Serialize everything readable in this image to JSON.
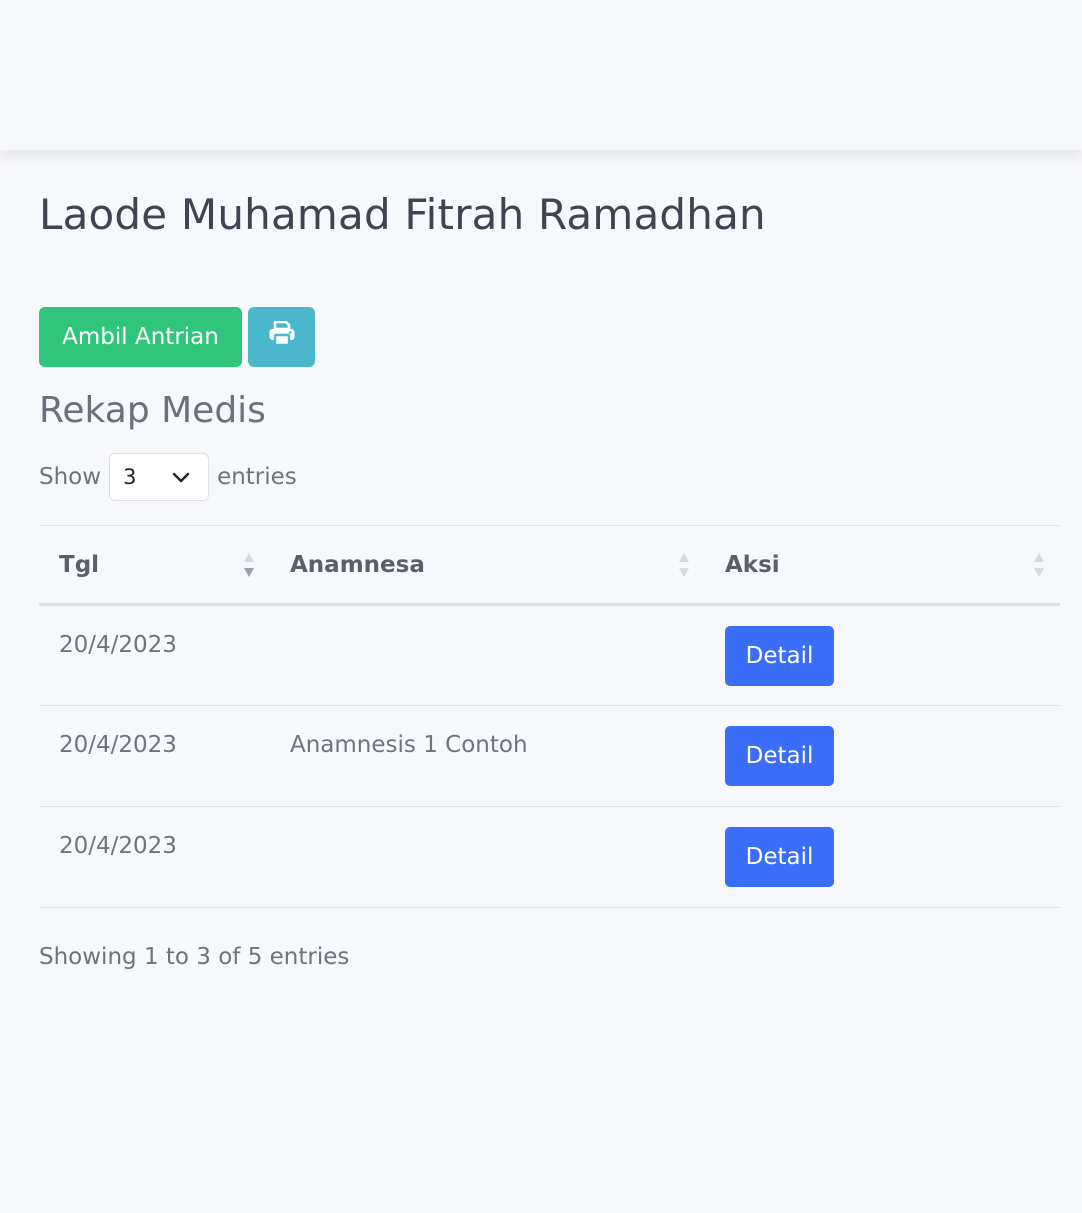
{
  "patient": {
    "name": "Laode Muhamad Fitrah Ramadhan"
  },
  "actions": {
    "queue_label": "Ambil Antrian",
    "print_icon": "print-icon"
  },
  "section": {
    "title": "Rekap Medis"
  },
  "length_menu": {
    "prefix": "Show",
    "selected": "3",
    "suffix": "entries"
  },
  "table": {
    "columns": [
      "Tgl",
      "Anamnesa",
      "Aksi"
    ],
    "rows": [
      {
        "tgl": "20/4/2023",
        "anamnesa": "",
        "action": "Detail"
      },
      {
        "tgl": "20/4/2023",
        "anamnesa": "Anamnesis 1 Contoh",
        "action": "Detail"
      },
      {
        "tgl": "20/4/2023",
        "anamnesa": "",
        "action": "Detail"
      }
    ]
  },
  "footer": {
    "info": "Showing 1 to 3 of 5 entries"
  },
  "colors": {
    "success": "#2fc57a",
    "info": "#4ab7cd",
    "primary": "#3b6ef8"
  }
}
